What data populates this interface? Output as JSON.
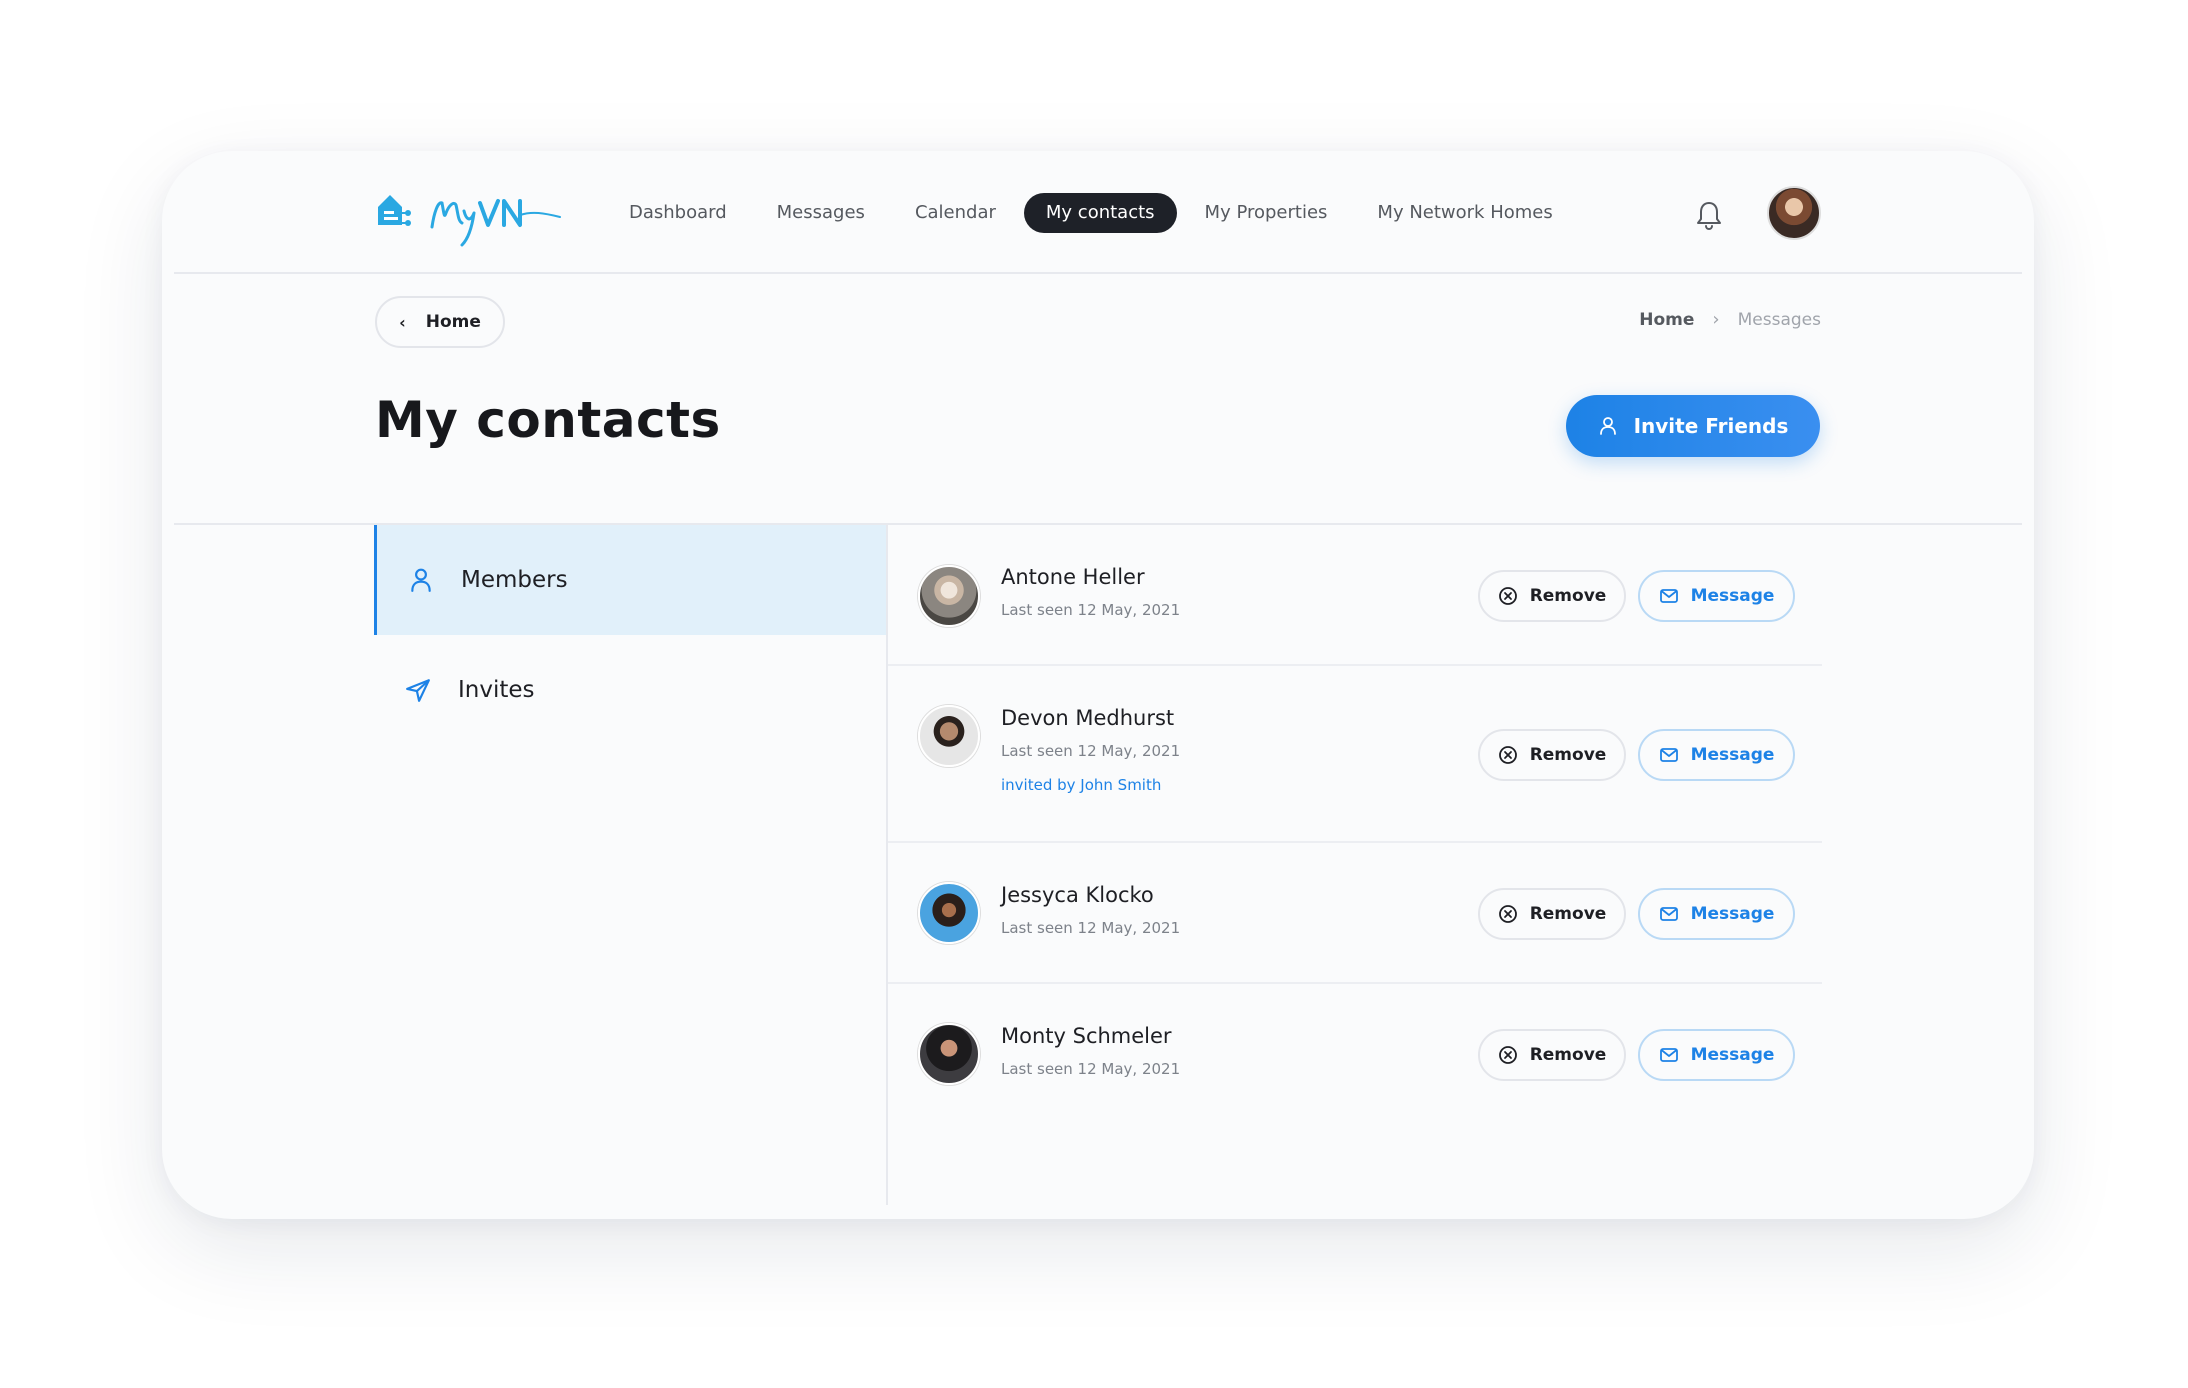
{
  "app": {
    "logo_text": "MyVN",
    "brand_color": "#1d82e6",
    "logo_color": "#2aa8e2"
  },
  "nav": {
    "items": [
      {
        "label": "Dashboard",
        "active": false
      },
      {
        "label": "Messages",
        "active": false
      },
      {
        "label": "Calendar",
        "active": false
      },
      {
        "label": "My contacts",
        "active": true
      },
      {
        "label": "My Properties",
        "active": false
      },
      {
        "label": "My Network Homes",
        "active": false
      }
    ],
    "notification_icon": "bell-icon",
    "profile_avatar": "user-avatar"
  },
  "subheader": {
    "back_label": "Home",
    "back_icon": "chevron-left-icon",
    "breadcrumb": {
      "home": "Home",
      "separator_icon": "chevron-right-icon",
      "current": "Messages"
    }
  },
  "page": {
    "title": "My contacts",
    "invite_button": "Invite Friends",
    "invite_icon": "user-icon"
  },
  "sidebar": {
    "items": [
      {
        "label": "Members",
        "icon": "user-icon",
        "active": true
      },
      {
        "label": "Invites",
        "icon": "send-icon",
        "active": false
      }
    ]
  },
  "contacts": [
    {
      "name": "Antone Heller",
      "last_seen": "Last seen 12 May, 2021",
      "invited_by": "",
      "remove_label": "Remove",
      "message_label": "Message"
    },
    {
      "name": "Devon Medhurst",
      "last_seen": "Last seen 12 May, 2021",
      "invited_by": "invited by John Smith",
      "remove_label": "Remove",
      "message_label": "Message"
    },
    {
      "name": "Jessyca Klocko",
      "last_seen": "Last seen 12 May, 2021",
      "invited_by": "",
      "remove_label": "Remove",
      "message_label": "Message"
    },
    {
      "name": "Monty Schmeler",
      "last_seen": "Last seen 12 May, 2021",
      "invited_by": "",
      "remove_label": "Remove",
      "message_label": "Message"
    }
  ]
}
